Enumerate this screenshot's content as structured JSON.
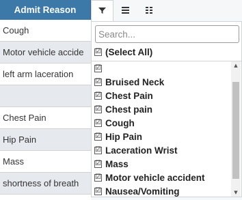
{
  "column": {
    "header": "Admit Reason",
    "rows": [
      "Cough",
      "Motor vehicle accide",
      "left arm laceration",
      "",
      "Chest Pain",
      "Hip Pain",
      "Mass",
      "shortness of breath"
    ]
  },
  "menu": {
    "tabs": [
      {
        "name": "filter",
        "icon": "filter-icon",
        "active": true
      },
      {
        "name": "general",
        "icon": "menu-lines-icon",
        "active": false
      },
      {
        "name": "columns",
        "icon": "columns-grid-icon",
        "active": false
      }
    ],
    "search": {
      "placeholder": "Search...",
      "value": ""
    },
    "select_all": {
      "label": "(Select All)",
      "checked": true
    },
    "items": [
      {
        "label": "",
        "checked": true
      },
      {
        "label": "Bruised Neck",
        "checked": true
      },
      {
        "label": "Chest Pain",
        "checked": true
      },
      {
        "label": "Chest pain",
        "checked": true
      },
      {
        "label": "Cough",
        "checked": true
      },
      {
        "label": "Hip Pain",
        "checked": true
      },
      {
        "label": "Laceration Wrist",
        "checked": true
      },
      {
        "label": "Mass",
        "checked": true
      },
      {
        "label": "Motor vehicle accident",
        "checked": true
      },
      {
        "label": "Nausea/Vomiting",
        "checked": true
      }
    ],
    "check_glyph": "☑",
    "colors": {
      "header_bg": "#3c79a8",
      "row_alt": "#e6e9ee"
    }
  }
}
